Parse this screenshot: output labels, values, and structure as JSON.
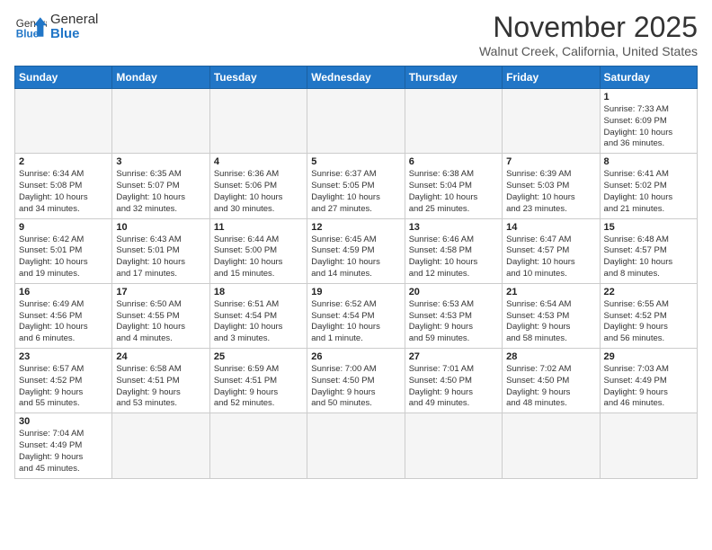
{
  "header": {
    "logo_general": "General",
    "logo_blue": "Blue",
    "month_title": "November 2025",
    "location": "Walnut Creek, California, United States"
  },
  "days_of_week": [
    "Sunday",
    "Monday",
    "Tuesday",
    "Wednesday",
    "Thursday",
    "Friday",
    "Saturday"
  ],
  "weeks": [
    [
      {
        "day": "",
        "info": ""
      },
      {
        "day": "",
        "info": ""
      },
      {
        "day": "",
        "info": ""
      },
      {
        "day": "",
        "info": ""
      },
      {
        "day": "",
        "info": ""
      },
      {
        "day": "",
        "info": ""
      },
      {
        "day": "1",
        "info": "Sunrise: 7:33 AM\nSunset: 6:09 PM\nDaylight: 10 hours\nand 36 minutes."
      }
    ],
    [
      {
        "day": "2",
        "info": "Sunrise: 6:34 AM\nSunset: 5:08 PM\nDaylight: 10 hours\nand 34 minutes."
      },
      {
        "day": "3",
        "info": "Sunrise: 6:35 AM\nSunset: 5:07 PM\nDaylight: 10 hours\nand 32 minutes."
      },
      {
        "day": "4",
        "info": "Sunrise: 6:36 AM\nSunset: 5:06 PM\nDaylight: 10 hours\nand 30 minutes."
      },
      {
        "day": "5",
        "info": "Sunrise: 6:37 AM\nSunset: 5:05 PM\nDaylight: 10 hours\nand 27 minutes."
      },
      {
        "day": "6",
        "info": "Sunrise: 6:38 AM\nSunset: 5:04 PM\nDaylight: 10 hours\nand 25 minutes."
      },
      {
        "day": "7",
        "info": "Sunrise: 6:39 AM\nSunset: 5:03 PM\nDaylight: 10 hours\nand 23 minutes."
      },
      {
        "day": "8",
        "info": "Sunrise: 6:41 AM\nSunset: 5:02 PM\nDaylight: 10 hours\nand 21 minutes."
      }
    ],
    [
      {
        "day": "9",
        "info": "Sunrise: 6:42 AM\nSunset: 5:01 PM\nDaylight: 10 hours\nand 19 minutes."
      },
      {
        "day": "10",
        "info": "Sunrise: 6:43 AM\nSunset: 5:01 PM\nDaylight: 10 hours\nand 17 minutes."
      },
      {
        "day": "11",
        "info": "Sunrise: 6:44 AM\nSunset: 5:00 PM\nDaylight: 10 hours\nand 15 minutes."
      },
      {
        "day": "12",
        "info": "Sunrise: 6:45 AM\nSunset: 4:59 PM\nDaylight: 10 hours\nand 14 minutes."
      },
      {
        "day": "13",
        "info": "Sunrise: 6:46 AM\nSunset: 4:58 PM\nDaylight: 10 hours\nand 12 minutes."
      },
      {
        "day": "14",
        "info": "Sunrise: 6:47 AM\nSunset: 4:57 PM\nDaylight: 10 hours\nand 10 minutes."
      },
      {
        "day": "15",
        "info": "Sunrise: 6:48 AM\nSunset: 4:57 PM\nDaylight: 10 hours\nand 8 minutes."
      }
    ],
    [
      {
        "day": "16",
        "info": "Sunrise: 6:49 AM\nSunset: 4:56 PM\nDaylight: 10 hours\nand 6 minutes."
      },
      {
        "day": "17",
        "info": "Sunrise: 6:50 AM\nSunset: 4:55 PM\nDaylight: 10 hours\nand 4 minutes."
      },
      {
        "day": "18",
        "info": "Sunrise: 6:51 AM\nSunset: 4:54 PM\nDaylight: 10 hours\nand 3 minutes."
      },
      {
        "day": "19",
        "info": "Sunrise: 6:52 AM\nSunset: 4:54 PM\nDaylight: 10 hours\nand 1 minute."
      },
      {
        "day": "20",
        "info": "Sunrise: 6:53 AM\nSunset: 4:53 PM\nDaylight: 9 hours\nand 59 minutes."
      },
      {
        "day": "21",
        "info": "Sunrise: 6:54 AM\nSunset: 4:53 PM\nDaylight: 9 hours\nand 58 minutes."
      },
      {
        "day": "22",
        "info": "Sunrise: 6:55 AM\nSunset: 4:52 PM\nDaylight: 9 hours\nand 56 minutes."
      }
    ],
    [
      {
        "day": "23",
        "info": "Sunrise: 6:57 AM\nSunset: 4:52 PM\nDaylight: 9 hours\nand 55 minutes."
      },
      {
        "day": "24",
        "info": "Sunrise: 6:58 AM\nSunset: 4:51 PM\nDaylight: 9 hours\nand 53 minutes."
      },
      {
        "day": "25",
        "info": "Sunrise: 6:59 AM\nSunset: 4:51 PM\nDaylight: 9 hours\nand 52 minutes."
      },
      {
        "day": "26",
        "info": "Sunrise: 7:00 AM\nSunset: 4:50 PM\nDaylight: 9 hours\nand 50 minutes."
      },
      {
        "day": "27",
        "info": "Sunrise: 7:01 AM\nSunset: 4:50 PM\nDaylight: 9 hours\nand 49 minutes."
      },
      {
        "day": "28",
        "info": "Sunrise: 7:02 AM\nSunset: 4:50 PM\nDaylight: 9 hours\nand 48 minutes."
      },
      {
        "day": "29",
        "info": "Sunrise: 7:03 AM\nSunset: 4:49 PM\nDaylight: 9 hours\nand 46 minutes."
      }
    ],
    [
      {
        "day": "30",
        "info": "Sunrise: 7:04 AM\nSunset: 4:49 PM\nDaylight: 9 hours\nand 45 minutes."
      },
      {
        "day": "",
        "info": ""
      },
      {
        "day": "",
        "info": ""
      },
      {
        "day": "",
        "info": ""
      },
      {
        "day": "",
        "info": ""
      },
      {
        "day": "",
        "info": ""
      },
      {
        "day": "",
        "info": ""
      }
    ]
  ]
}
